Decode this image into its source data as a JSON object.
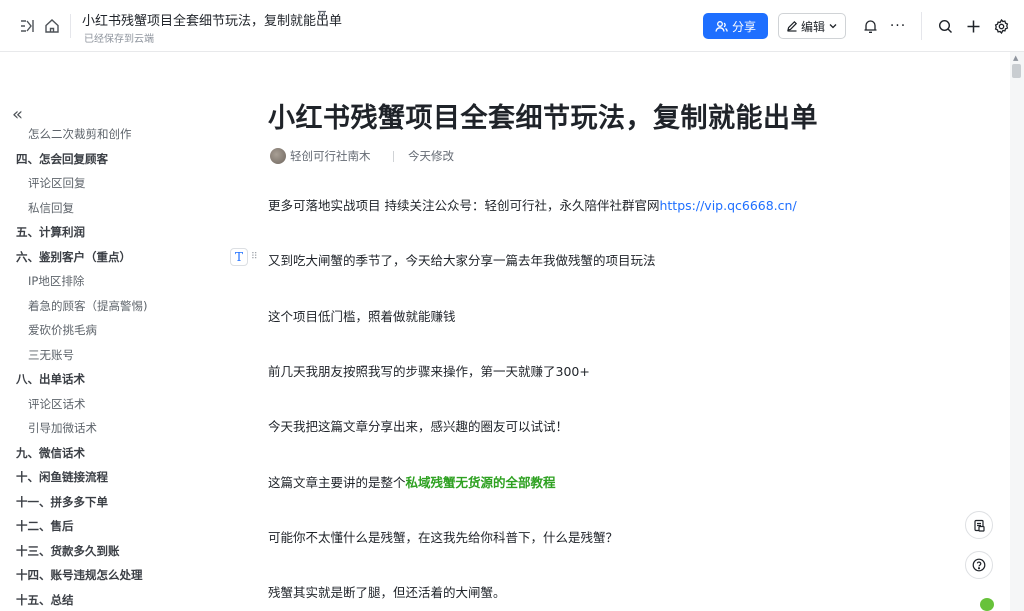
{
  "header": {
    "doc_title": "小红书残蟹项目全套细节玩法，复制就能出单",
    "pin_icon": "pin-icon",
    "saved_status": "已经保存到云端",
    "share_label": "分享",
    "edit_label": "编辑",
    "accent": "#1e6fff"
  },
  "sidebar": {
    "items": [
      {
        "label": "怎么二次裁剪和创作",
        "level": "sub"
      },
      {
        "label": "四、怎会回复顾客",
        "level": "h"
      },
      {
        "label": "评论区回复",
        "level": "sub"
      },
      {
        "label": "私信回复",
        "level": "sub"
      },
      {
        "label": "五、计算利润",
        "level": "h"
      },
      {
        "label": "六、鉴别客户（重点）",
        "level": "h"
      },
      {
        "label": "IP地区排除",
        "level": "sub"
      },
      {
        "label": "着急的顾客（提高警惕)",
        "level": "sub"
      },
      {
        "label": "爱砍价挑毛病",
        "level": "sub"
      },
      {
        "label": "三无账号",
        "level": "sub"
      },
      {
        "label": "八、出单话术",
        "level": "h"
      },
      {
        "label": "评论区话术",
        "level": "sub"
      },
      {
        "label": "引导加微话术",
        "level": "sub"
      },
      {
        "label": "九、微信话术",
        "level": "h"
      },
      {
        "label": "十、闲鱼链接流程",
        "level": "h"
      },
      {
        "label": "十一、拼多多下单",
        "level": "h"
      },
      {
        "label": "十二、售后",
        "level": "h"
      },
      {
        "label": "十三、货款多久到账",
        "level": "h"
      },
      {
        "label": "十四、账号违规怎么处理",
        "level": "h"
      },
      {
        "label": "十五、总结",
        "level": "h"
      }
    ]
  },
  "doc": {
    "title": "小红书残蟹项目全套细节玩法，复制就能出单",
    "author": "轻创可行社南木",
    "modified": "今天修改",
    "p1_text": "更多可落地实战项目 持续关注公众号：轻创可行社，永久陪伴社群官网",
    "p1_link": "https://vip.qc6668.cn/",
    "p2": "又到吃大闸蟹的季节了，今天给大家分享一篇去年我做残蟹的项目玩法",
    "p3": "这个项目低门槛，照着做就能赚钱",
    "p4": "前几天我朋友按照我写的步骤来操作，第一天就赚了300+",
    "p5": "今天我把这篇文章分享出来，感兴趣的圈友可以试试！",
    "p6_prefix": "这篇文章主要讲的是整个",
    "p6_highlight": "私域残蟹无货源的全部教程",
    "p7": "可能你不太懂什么是残蟹，在这我先给你科普下，什么是残蟹？",
    "p8": "残蟹其实就是断了腿，但还活着的大闸蟹。",
    "block_type_label": "T"
  }
}
